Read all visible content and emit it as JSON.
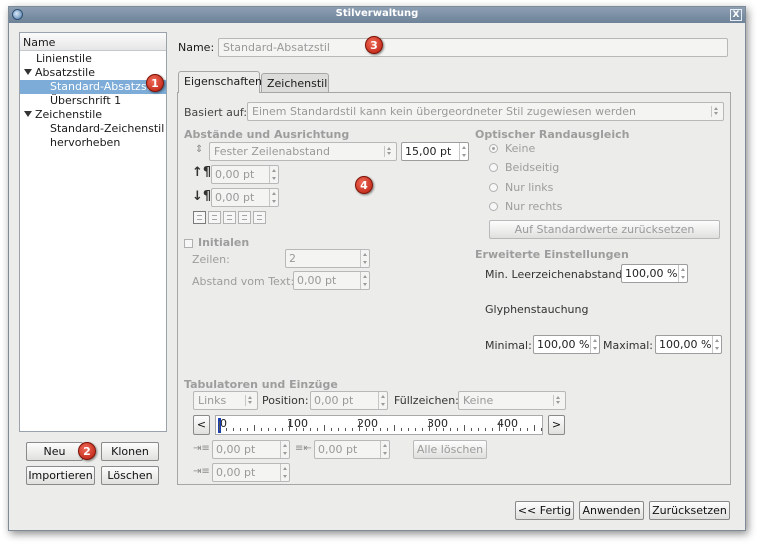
{
  "window": {
    "title": "Stilverwaltung",
    "close_glyph": "X"
  },
  "tree": {
    "header": "Name",
    "items": [
      {
        "label": "Linienstile",
        "level": 0,
        "expanded": false,
        "selected": false
      },
      {
        "label": "Absatzstile",
        "level": 0,
        "expanded": true,
        "selected": false
      },
      {
        "label": "Standard-Absatzstil",
        "level": 1,
        "selected": true
      },
      {
        "label": "Überschrift 1",
        "level": 1,
        "selected": false
      },
      {
        "label": "Zeichenstile",
        "level": 0,
        "expanded": true,
        "selected": false
      },
      {
        "label": "Standard-Zeichenstil",
        "level": 1,
        "selected": false
      },
      {
        "label": "hervorheben",
        "level": 1,
        "selected": false
      }
    ]
  },
  "left_buttons": {
    "new": "Neu",
    "clone": "Klonen",
    "import": "Importieren",
    "delete": "Löschen"
  },
  "name": {
    "label": "Name:",
    "value": "Standard-Absatzstil"
  },
  "tabs": [
    {
      "label": "Eigenschaften",
      "active": true
    },
    {
      "label": "Zeichenstil",
      "active": false
    }
  ],
  "based_on": {
    "label": "Basiert auf:",
    "value": "Einem Standardstil kann kein übergeordneter Stil zugewiesen werden"
  },
  "spacing": {
    "heading": "Abstände und Ausrichtung",
    "line_mode": "Fester Zeilenabstand",
    "line_value": "15,00 pt",
    "above": "0,00 pt",
    "below": "0,00 pt"
  },
  "optical_margin": {
    "heading": "Optischer Randausgleich",
    "options": [
      "Keine",
      "Beidseitig",
      "Nur links",
      "Nur rechts"
    ],
    "selected": "Keine",
    "reset_button": "Auf Standardwerte zurücksetzen"
  },
  "initials": {
    "heading": "Initialen",
    "lines_label": "Zeilen:",
    "lines_value": "2",
    "distance_label": "Abstand vom Text:",
    "distance_value": "0,00 pt"
  },
  "advanced": {
    "heading": "Erweiterte Einstellungen",
    "min_space_label": "Min. Leerzeichenabstand:",
    "min_space_value": "100,00 %",
    "glyph_label": "Glyphenstauchung",
    "minimal_label": "Minimal:",
    "minimal_value": "100,00 %",
    "maximal_label": "Maximal:",
    "maximal_value": "100,00 %"
  },
  "tabs_section": {
    "heading": "Tabulatoren und Einzüge",
    "align_value": "Links",
    "position_label": "Position:",
    "position_value": "0,00 pt",
    "fill_label": "Füllzeichen:",
    "fill_value": "Keine",
    "ruler_labels": [
      "0",
      "100",
      "200",
      "300",
      "400"
    ],
    "indent_first": "0,00 pt",
    "indent_right": "0,00 pt",
    "indent_left": "0,00 pt",
    "delete_all": "Alle löschen",
    "scroll_left": "<",
    "scroll_right": ">"
  },
  "footer": {
    "done": "<< Fertig",
    "apply": "Anwenden",
    "reset": "Zurücksetzen"
  },
  "markers": [
    "1",
    "2",
    "3",
    "4"
  ],
  "colors": {
    "selection": "#7cacd7",
    "titlebar": "#7b8fa5",
    "marker": "#d9321e"
  }
}
